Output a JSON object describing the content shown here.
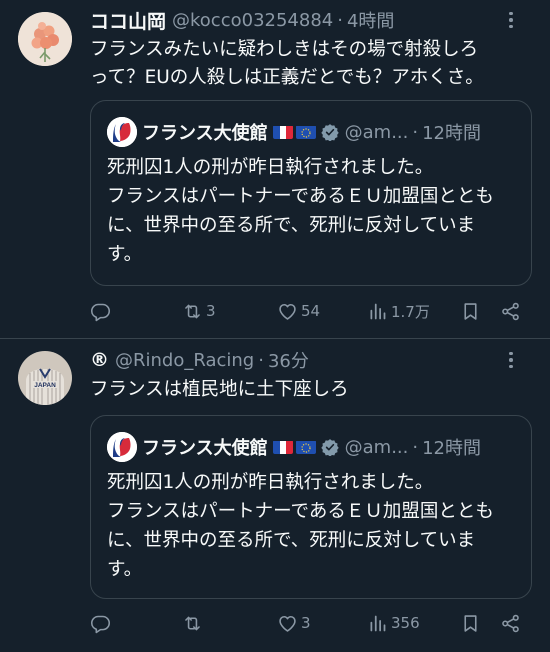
{
  "tweets": [
    {
      "display_name": "ココ山岡",
      "handle": "@kocco03254884",
      "separator": "·",
      "time": "4時間",
      "text_lines": [
        "フランスみたいに疑わしきはその場で射殺しろ",
        "って？EUの人殺しは正義だとでも？アホくさ。"
      ],
      "quote": {
        "display_name": "フランス大使館",
        "handle": "@am...",
        "separator": "·",
        "time": "12時間",
        "text_lines": [
          "死刑囚1人の刑が昨日執行されました。",
          "フランスはパートナーであるＥＵ加盟国ととも",
          "に、世界中の至る所で、死刑に反対していま",
          "す。"
        ]
      },
      "actions": {
        "reply": "",
        "retweet": "3",
        "like": "54",
        "views": "1.7万"
      }
    },
    {
      "display_name": "®",
      "handle": "@Rindo_Racing",
      "separator": "·",
      "time": "36分",
      "text_lines": [
        "フランスは植民地に土下座しろ"
      ],
      "quote": {
        "display_name": "フランス大使館",
        "handle": "@am...",
        "separator": "·",
        "time": "12時間",
        "text_lines": [
          "死刑囚1人の刑が昨日執行されました。",
          "フランスはパートナーであるＥＵ加盟国ととも",
          "に、世界中の至る所で、死刑に反対していま",
          "す。"
        ]
      },
      "actions": {
        "reply": "",
        "retweet": "",
        "like": "3",
        "views": "356"
      }
    }
  ],
  "icons": {
    "reply": "reply-icon",
    "retweet": "retweet-icon",
    "like": "heart-icon",
    "views": "views-icon",
    "bookmark": "bookmark-icon",
    "share": "share-icon",
    "more": "more-icon",
    "verified": "verified-icon"
  },
  "colors": {
    "background": "#15202b",
    "text": "#f7f9f9",
    "secondary": "#8b98a5",
    "border": "#38444d",
    "verified": "#829aab"
  }
}
